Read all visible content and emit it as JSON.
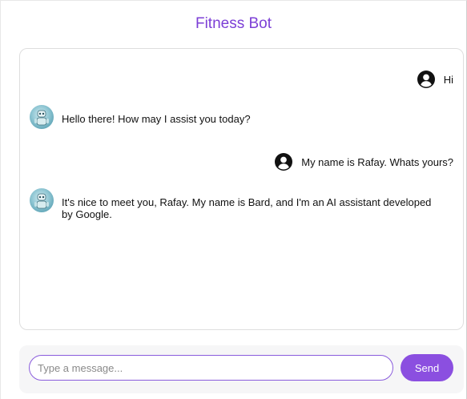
{
  "header": {
    "title": "Fitness Bot"
  },
  "colors": {
    "accent": "#7c3fd6",
    "send_button": "#8b4fe0"
  },
  "messages": [
    {
      "sender": "user",
      "icon": "user-circle-icon",
      "text": "Hi"
    },
    {
      "sender": "bot",
      "icon": "robot-avatar-icon",
      "text": "Hello there! How may I assist you today?"
    },
    {
      "sender": "user",
      "icon": "user-circle-icon",
      "text": "My name is Rafay. Whats yours?"
    },
    {
      "sender": "bot",
      "icon": "robot-avatar-icon",
      "text": "It's nice to meet you, Rafay. My name is Bard, and I'm an AI assistant developed by Google."
    }
  ],
  "composer": {
    "value": "",
    "placeholder": "Type a message...",
    "send_label": "Send"
  }
}
